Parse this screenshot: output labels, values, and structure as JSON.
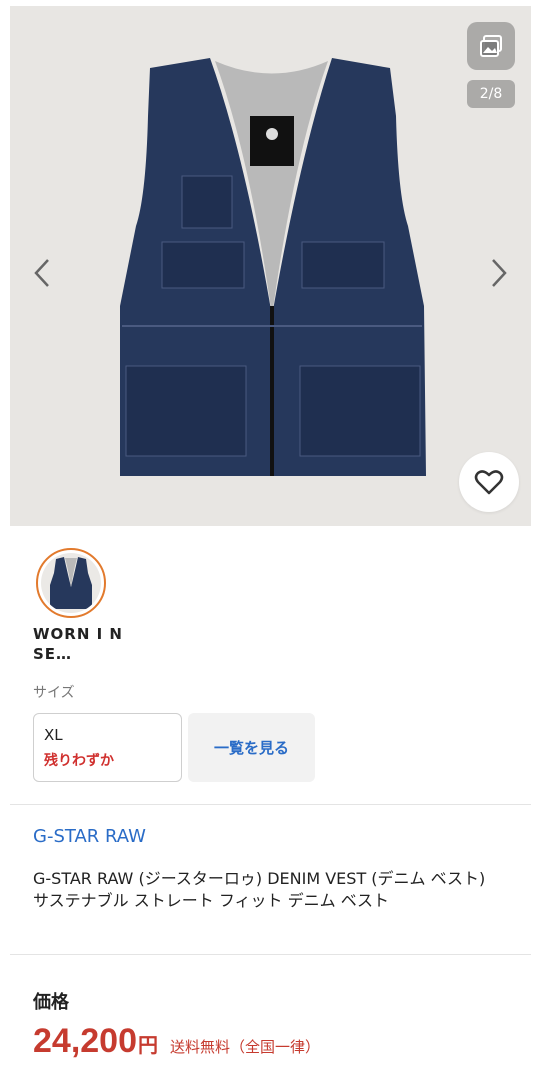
{
  "gallery": {
    "counter": "2/8",
    "colors": {
      "denim": "#26385c",
      "lining": "#b9b9b9",
      "background": "#e8e6e3"
    },
    "icons": [
      "gallery-icon",
      "chevron-left-icon",
      "chevron-right-icon",
      "heart-icon"
    ]
  },
  "color_option": {
    "label": "WORN I N SE…",
    "selected_border": "#e27a2d"
  },
  "size": {
    "label": "サイズ",
    "option": {
      "size": "XL",
      "stock": "残りわずか"
    },
    "view_all": "一覧を見る"
  },
  "product": {
    "brand": "G-STAR RAW",
    "name": "G-STAR RAW (ジースターロゥ) DENIM VEST (デニム ベスト) サステナブル ストレート フィット デニム ベスト"
  },
  "price": {
    "label": "価格",
    "value": "24,200",
    "currency": "円",
    "shipping": "送料無料（全国一律）",
    "color": "#c63b2f"
  }
}
